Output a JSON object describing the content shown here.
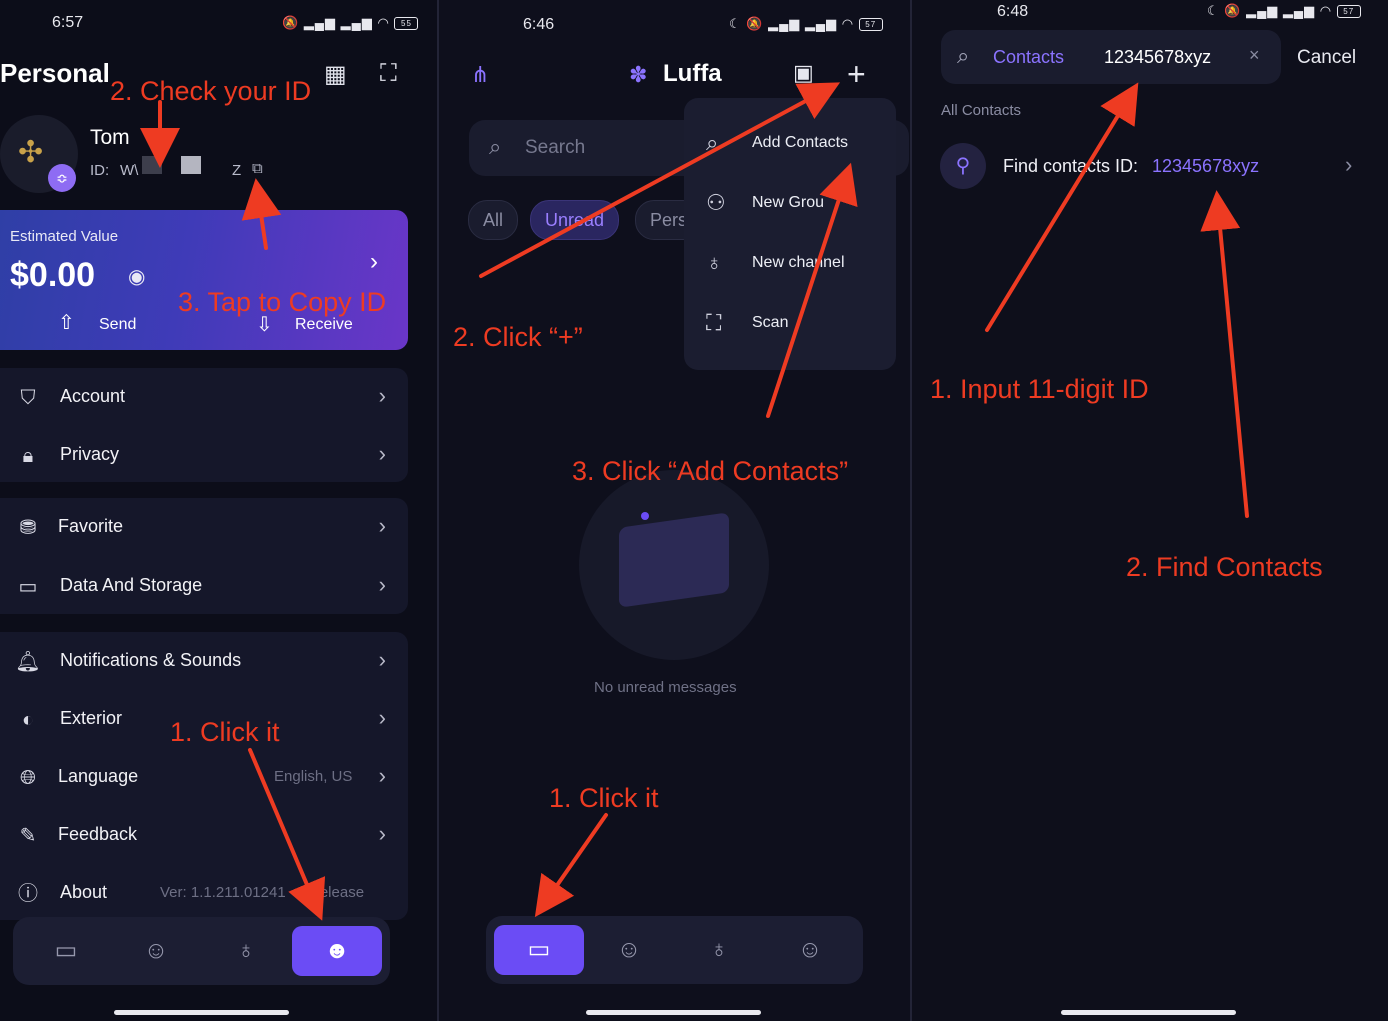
{
  "colors": {
    "accent": "#6b4cf5",
    "annotation": "#ee3b22",
    "link": "#8b73ff"
  },
  "panel1": {
    "status": {
      "time": "6:57",
      "battery": "55"
    },
    "header": {
      "title": "Personal"
    },
    "profile": {
      "name": "Tom",
      "id_label": "ID:",
      "id_value": "W\\",
      "id_suffix": "Z"
    },
    "wallet": {
      "title": "Estimated Value",
      "amount": "$0.00",
      "send": "Send",
      "receive": "Receive"
    },
    "menu": [
      {
        "label": "Account",
        "icon": "shield-icon"
      },
      {
        "label": "Privacy",
        "icon": "lock-icon"
      },
      {
        "label": "Favorite",
        "icon": "bookmark-icon"
      },
      {
        "label": "Data And Storage",
        "icon": "storage-icon"
      },
      {
        "label": "Notifications & Sounds",
        "icon": "bell-icon"
      },
      {
        "label": "Exterior",
        "icon": "palette-icon"
      },
      {
        "label": "Language",
        "icon": "globe-icon",
        "value": "English, US"
      },
      {
        "label": "Feedback",
        "icon": "feedback-icon"
      },
      {
        "label": "About",
        "icon": "info-icon",
        "value": "Ver: 1.1.211.01241       release"
      }
    ],
    "annotations": {
      "check_id": "2. Check your ID",
      "copy_id": "3. Tap to Copy ID",
      "click_it": "1. Click it"
    }
  },
  "panel2": {
    "status": {
      "time": "6:46",
      "battery": "57"
    },
    "header": {
      "title": "Luffa"
    },
    "search": {
      "placeholder": "Search"
    },
    "chips": [
      "All",
      "Unread",
      "Pers"
    ],
    "menu": [
      {
        "label": "Add Contacts",
        "icon": "search-icon"
      },
      {
        "label": "New Grou",
        "icon": "group-icon"
      },
      {
        "label": "New channel",
        "icon": "channel-icon"
      },
      {
        "label": "Scan",
        "icon": "scan-icon"
      }
    ],
    "empty": {
      "text": "No unread messages"
    },
    "annotations": {
      "click_plus": "2. Click “+”",
      "add_contacts": "3. Click “Add Contacts”",
      "click_it": "1. Click it"
    }
  },
  "panel3": {
    "status": {
      "time": "6:48",
      "battery": "57"
    },
    "search": {
      "prefix": "Contacts",
      "value": "12345678xyz",
      "cancel": "Cancel"
    },
    "section": "All Contacts",
    "result": {
      "label": "Find contacts ID:",
      "id": "12345678xyz"
    },
    "annotations": {
      "input_id": "1. Input 11-digit ID",
      "find_contacts": "2. Find Contacts"
    }
  }
}
